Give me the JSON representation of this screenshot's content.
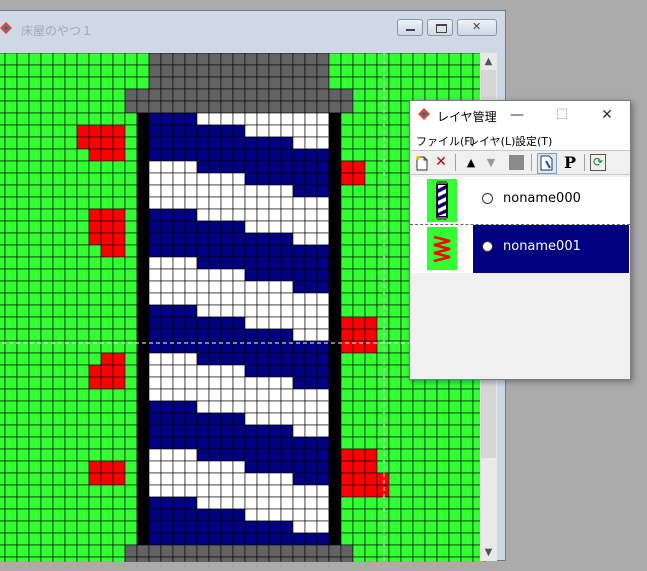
{
  "main_window": {
    "title": "床屋のやつ１",
    "buttons": [
      "minimize",
      "maximize",
      "close"
    ]
  },
  "canvas": {
    "colors": {
      "grid_line": "#000000",
      "background": "#33ff33",
      "pole_blue": "#000080",
      "pole_white": "#ffffff",
      "cap_gray": "#636363",
      "outline_black": "#000000",
      "accent_red": "#ff0000"
    }
  },
  "layer_window": {
    "title": "レイヤ管理",
    "menu": [
      "ファイル(F)",
      "レイヤ(L)",
      "設定(T)"
    ],
    "toolbar": [
      "new-layer-icon",
      "delete-layer-icon",
      "move-up-icon",
      "move-down-icon",
      "gray-box-icon",
      "edit-layer-icon",
      "properties-icon",
      "refresh-icon"
    ],
    "toolbar_glyphs": {
      "delete": "✕",
      "up": "▲",
      "down": "▼",
      "props": "P",
      "refresh": "⟳",
      "close": "✕",
      "min": "—",
      "max": "☐"
    },
    "layers": [
      {
        "name": "noname000",
        "selected": false,
        "thumb": "barber-pole-icon"
      },
      {
        "name": "noname001",
        "selected": true,
        "thumb": "red-zigzag-icon"
      }
    ]
  }
}
